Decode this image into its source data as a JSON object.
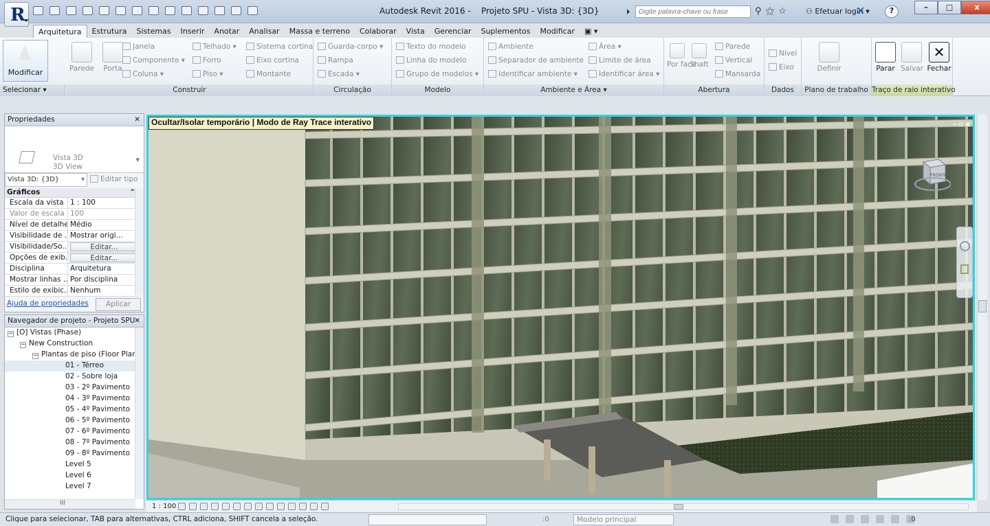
{
  "app": {
    "title": "Autodesk Revit 2016 -    Projeto SPU - Vista 3D: {3D}",
    "logo_letter": "R",
    "search_placeholder": "Digite palavra-chave ou frase",
    "login_label": "Efetuar login",
    "help_label": "?",
    "window_buttons": {
      "minimize": "–",
      "maximize": "□",
      "close": "x"
    }
  },
  "tabs": [
    "Arquitetura",
    "Estrutura",
    "Sistemas",
    "Inserir",
    "Anotar",
    "Analisar",
    "Massa e terreno",
    "Colaborar",
    "Vista",
    "Gerenciar",
    "Suplementos",
    "Modificar",
    "▣ ▾"
  ],
  "ribbon": {
    "modify_label": "Modificar",
    "select_label": "Selecionar ▾",
    "construir": {
      "label": "Construir",
      "wall": "Parede",
      "door": "Porta",
      "items": [
        "Janela",
        "Componente ▾",
        "Coluna ▾",
        "Telhado ▾",
        "Forro",
        "Piso ▾",
        "Sistema cortina",
        "Eixo cortina",
        "Montante"
      ]
    },
    "circulacao": {
      "label": "Circulação",
      "items": [
        "Guarda-corpo ▾",
        "Rampa",
        "Escada ▾"
      ]
    },
    "modelo": {
      "label": "Modelo",
      "items": [
        "Texto do modelo",
        "Linha do modelo",
        "Grupo de modelos ▾"
      ]
    },
    "ambiente": {
      "label": "Ambiente e Área ▾",
      "items": [
        "Ambiente",
        "Separador de ambiente",
        "Identificar ambiente ▾",
        "Área ▾",
        "Limite de área",
        "Identificar área ▾"
      ]
    },
    "abertura": {
      "label": "Abertura",
      "items": [
        "Por face",
        "Shaft",
        "Parede",
        "Vertical",
        "Mansarda"
      ]
    },
    "dados": {
      "label": "Dados",
      "items": [
        "Nível",
        "Eixo"
      ]
    },
    "plano": {
      "label": "Plano de trabalho",
      "items": [
        "Definir"
      ]
    },
    "traco": {
      "label": "Traço de raio interativo",
      "items": [
        "Parar",
        "Salvar",
        "Fechar"
      ]
    }
  },
  "properties": {
    "header": "Propriedades",
    "type_line1": "Vista 3D",
    "type_line2": "3D View",
    "view_dropdown": "Vista 3D: {3D}",
    "edit_type": "Editar tipo",
    "group": "Gráficos",
    "rows": [
      {
        "k": "Escala da vista",
        "v": "1 : 100"
      },
      {
        "k": "Valor de escala ...",
        "v": "100"
      },
      {
        "k": "Nível de detalhe",
        "v": "Médio"
      },
      {
        "k": "Visibilidade de ...",
        "v": "Mostrar origi..."
      },
      {
        "k": "Visibilidade/So...",
        "v": "Editar..."
      },
      {
        "k": "Opções de exib...",
        "v": "Editar..."
      },
      {
        "k": "Disciplina",
        "v": "Arquitetura"
      },
      {
        "k": "Mostrar linhas ...",
        "v": "Por disciplina"
      },
      {
        "k": "Estilo de exibic...",
        "v": "Nenhum"
      }
    ],
    "help_link": "Ajuda de propriedades",
    "apply": "Aplicar"
  },
  "navigator": {
    "header": "Navegador de projeto - Projeto SPU",
    "root": "Vistas (Phase)",
    "phase": "New Construction",
    "category": "Plantas de piso (Floor Plan",
    "items": [
      "01 - Térreo",
      "02 - Sobre loja",
      "03 - 2º Pavimento",
      "04 - 3º Pavimento",
      "05 - 4º Pavimento",
      "06 - 5º Pavimento",
      "07 - 6º Pavimento",
      "08 - 7º Pavimento",
      "09 - 8º Pavimento",
      "Level 5",
      "Level 6",
      "Level 7"
    ],
    "scroll_mark": "III"
  },
  "viewport": {
    "banner": "Ocultar/Isolar temporário | Modo de Ray Trace interativo",
    "viewcube_label": "FRONTAL",
    "view_buttons": "– ▫ x"
  },
  "view_control": {
    "scale": "1 : 100"
  },
  "status": {
    "message": "Clique para selecionar, TAB para alternativas, CTRL adiciona, SHIFT cancela a seleção.",
    "zero_a": ":0",
    "model": "Modelo principal",
    "zero_b": ":0"
  }
}
